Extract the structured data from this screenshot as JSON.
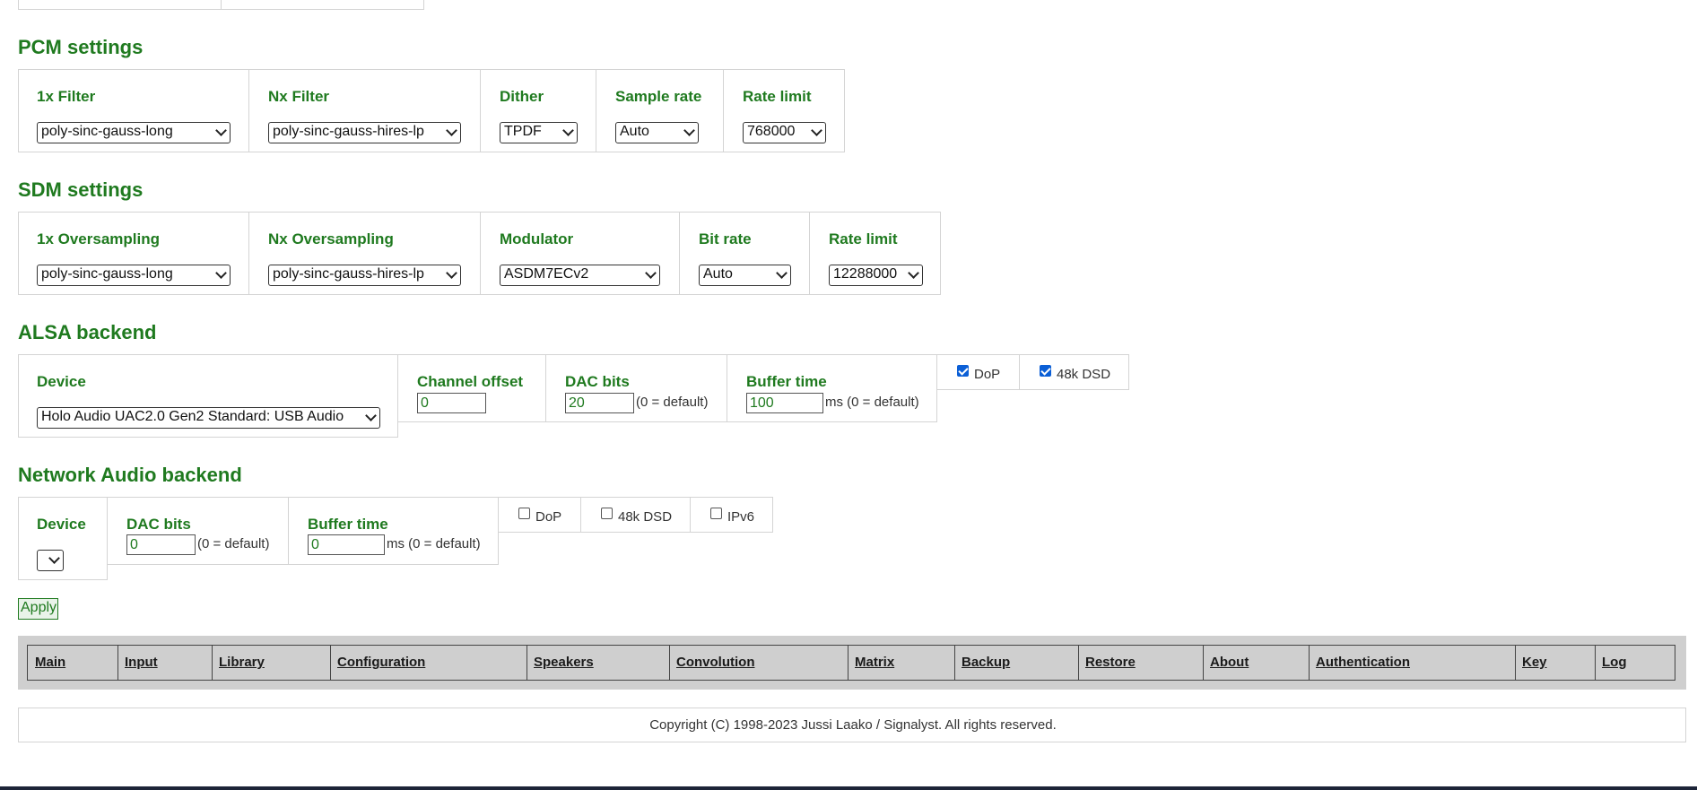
{
  "pcm": {
    "title": "PCM settings",
    "filter1x": {
      "label": "1x Filter",
      "value": "poly-sinc-gauss-long"
    },
    "filterNx": {
      "label": "Nx Filter",
      "value": "poly-sinc-gauss-hires-lp"
    },
    "dither": {
      "label": "Dither",
      "value": "TPDF"
    },
    "sample_rate": {
      "label": "Sample rate",
      "value": "Auto"
    },
    "rate_limit": {
      "label": "Rate limit",
      "value": "768000"
    }
  },
  "sdm": {
    "title": "SDM settings",
    "os1x": {
      "label": "1x Oversampling",
      "value": "poly-sinc-gauss-long"
    },
    "osNx": {
      "label": "Nx Oversampling",
      "value": "poly-sinc-gauss-hires-lp"
    },
    "modulator": {
      "label": "Modulator",
      "value": "ASDM7ECv2"
    },
    "bit_rate": {
      "label": "Bit rate",
      "value": "Auto"
    },
    "rate_limit": {
      "label": "Rate limit",
      "value": "12288000"
    }
  },
  "alsa": {
    "title": "ALSA backend",
    "device": {
      "label": "Device",
      "value": "Holo Audio UAC2.0 Gen2 Standard: USB Audio"
    },
    "channel_offset": {
      "label": "Channel offset",
      "value": "0"
    },
    "dac_bits": {
      "label": "DAC bits",
      "value": "20",
      "note": "(0 = default)"
    },
    "buffer_time": {
      "label": "Buffer time",
      "value": "100",
      "note": "ms (0 = default)"
    },
    "dop": {
      "label": "DoP",
      "checked": true
    },
    "dsd48k": {
      "label": "48k DSD",
      "checked": true
    }
  },
  "network": {
    "title": "Network Audio backend",
    "device": {
      "label": "Device",
      "value": ""
    },
    "dac_bits": {
      "label": "DAC bits",
      "value": "0",
      "note": "(0 = default)"
    },
    "buffer_time": {
      "label": "Buffer time",
      "value": "0",
      "note": "ms (0 = default)"
    },
    "dop": {
      "label": "DoP",
      "checked": false
    },
    "dsd48k": {
      "label": "48k DSD",
      "checked": false
    },
    "ipv6": {
      "label": "IPv6",
      "checked": false
    }
  },
  "apply_label": "Apply",
  "nav": [
    "Main",
    "Input",
    "Library",
    "Configuration",
    "Speakers",
    "Convolution",
    "Matrix",
    "Backup",
    "Restore",
    "About",
    "Authentication",
    "Key",
    "Log"
  ],
  "footer": "Copyright (C) 1998-2023 Jussi Laako / Signalyst. All rights reserved.",
  "colors": {
    "accent": "#1f7a1f",
    "checkbox": "#0b5fd6",
    "navbar": "#cfcfcf"
  }
}
